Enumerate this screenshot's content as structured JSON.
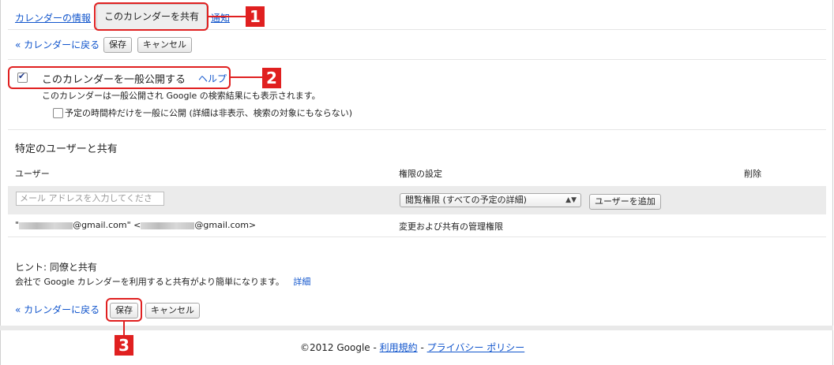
{
  "tabs": {
    "calendar_info": "カレンダーの情報",
    "share_calendar": "このカレンダーを共有",
    "notifications": "通知"
  },
  "toolbar_top": {
    "back_link": "« カレンダーに戻る",
    "save": "保存",
    "cancel": "キャンセル"
  },
  "public_section": {
    "make_public_label": "このカレンダーを一般公開する",
    "make_public_checked": true,
    "help_link": "ヘルプ",
    "public_note": "このカレンダーは一般公開され Google の検索結果にも表示されます。",
    "freebusy_label": "予定の時間枠だけを一般に公開 (詳細は非表示、検索の対象にもならない)",
    "freebusy_checked": false
  },
  "share_section": {
    "title": "特定のユーザーと共有",
    "col_user": "ユーザー",
    "col_permission": "権限の設定",
    "col_delete": "削除",
    "email_placeholder": "メール アドレスを入力してくださ",
    "permission_selected": "閲覧権限 (すべての予定の詳細)",
    "add_user_button": "ユーザーを追加",
    "users": [
      {
        "prefix": "\"",
        "mid": "@gmail.com\" <",
        "suffix": "@gmail.com>",
        "permission": "変更および共有の管理権限"
      }
    ]
  },
  "hint": {
    "title": "ヒント: 同僚と共有",
    "text": "会社で Google カレンダーを利用すると共有がより簡単になります。",
    "details_link": "詳細"
  },
  "toolbar_bottom": {
    "back_link": "« カレンダーに戻る",
    "save": "保存",
    "cancel": "キャンセル"
  },
  "footer": {
    "copyright": "©2012 Google - ",
    "terms": "利用規約",
    "sep": " - ",
    "privacy": "プライバシー ポリシー"
  },
  "callouts": {
    "one": "1",
    "two": "2",
    "three": "3"
  },
  "colors": {
    "link": "#1155cc",
    "callout": "#e02020"
  }
}
